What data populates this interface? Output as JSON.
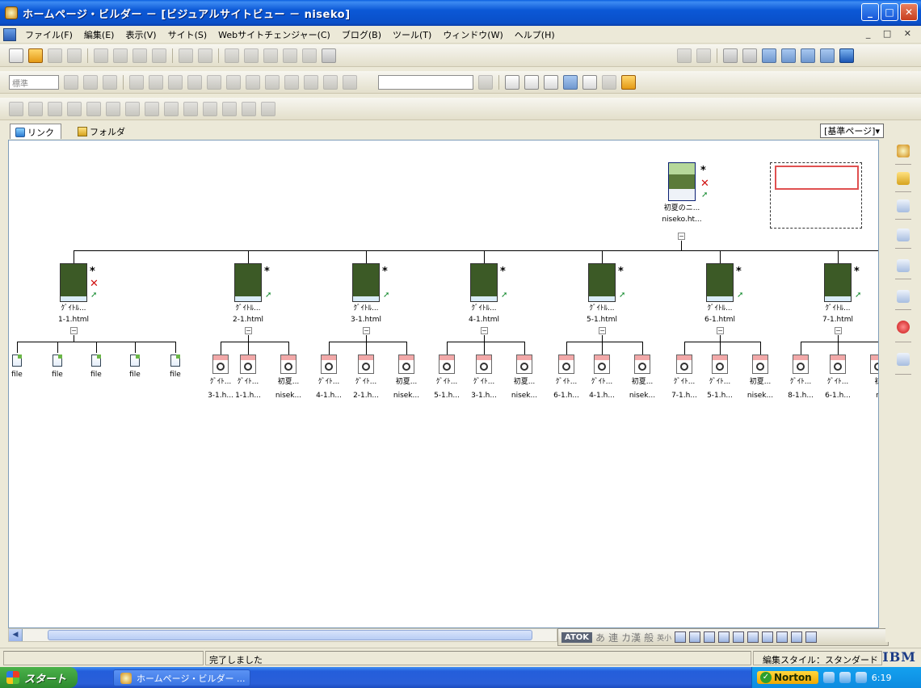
{
  "window": {
    "title": "ホームページ・ビルダー － [ビジュアルサイトビュー － niseko]",
    "controls": {
      "minimize": "_",
      "maximize": "□",
      "close": "✕"
    }
  },
  "menu": {
    "items": [
      "ファイル(F)",
      "編集(E)",
      "表示(V)",
      "サイト(S)",
      "Webサイトチェンジャー(C)",
      "ブログ(B)",
      "ツール(T)",
      "ウィンドウ(W)",
      "ヘルプ(H)"
    ],
    "mdi_controls": "_ □ ✕"
  },
  "toolbar2": {
    "style_select": "標準"
  },
  "tabs": {
    "link": "リンク",
    "folder": "フォルダ",
    "std_page": "[基準ページ]▾"
  },
  "site": {
    "top_page": {
      "title": "初夏のニ...",
      "file": "niseko.ht..."
    },
    "level1": [
      {
        "title": "ｸﾞｲﾄﾙ...",
        "file": "1-1.html"
      },
      {
        "title": "ｸﾞｲﾄﾙ...",
        "file": "2-1.html"
      },
      {
        "title": "ｸﾞｲﾄﾙ...",
        "file": "3-1.html"
      },
      {
        "title": "ｸﾞｲﾄﾙ...",
        "file": "4-1.html"
      },
      {
        "title": "ｸﾞｲﾄﾙ...",
        "file": "5-1.html"
      },
      {
        "title": "ｸﾞｲﾄﾙ...",
        "file": "6-1.html"
      },
      {
        "title": "ｸﾞｲﾄﾙ...",
        "file": "7-1.html"
      }
    ],
    "files": [
      "file",
      "file",
      "file",
      "file",
      "file"
    ],
    "leaves": [
      {
        "title": "ｸﾞｲﾄ...",
        "file": "3-1.h..."
      },
      {
        "title": "ｸﾞｲﾄ...",
        "file": "1-1.h..."
      },
      {
        "title": "初夏...",
        "file": "nisek..."
      },
      {
        "title": "ｸﾞｲﾄ...",
        "file": "4-1.h..."
      },
      {
        "title": "ｸﾞｲﾄ...",
        "file": "2-1.h..."
      },
      {
        "title": "初夏...",
        "file": "nisek..."
      },
      {
        "title": "ｸﾞｲﾄ...",
        "file": "5-1.h..."
      },
      {
        "title": "ｸﾞｲﾄ...",
        "file": "3-1.h..."
      },
      {
        "title": "初夏...",
        "file": "nisek..."
      },
      {
        "title": "ｸﾞｲﾄ...",
        "file": "6-1.h..."
      },
      {
        "title": "ｸﾞｲﾄ...",
        "file": "4-1.h..."
      },
      {
        "title": "初夏...",
        "file": "nisek..."
      },
      {
        "title": "ｸﾞｲﾄ...",
        "file": "7-1.h..."
      },
      {
        "title": "ｸﾞｲﾄ...",
        "file": "5-1.h..."
      },
      {
        "title": "初夏...",
        "file": "nisek..."
      },
      {
        "title": "ｸﾞｲﾄ...",
        "file": "8-1.h..."
      },
      {
        "title": "ｸﾞｲﾄ...",
        "file": "6-1.h..."
      },
      {
        "title": "初",
        "file": "n"
      }
    ]
  },
  "ime": {
    "atok": "ATOK",
    "keys": [
      "あ",
      "連",
      "カ漢",
      "般",
      "英小"
    ]
  },
  "status": {
    "message": "完了しました",
    "edit_style": "編集スタイル：スタンダード",
    "brand": "IBM"
  },
  "taskbar": {
    "start": "スタート",
    "task": "ホームページ・ビルダー ...",
    "norton": "Norton",
    "time": "6:19"
  }
}
